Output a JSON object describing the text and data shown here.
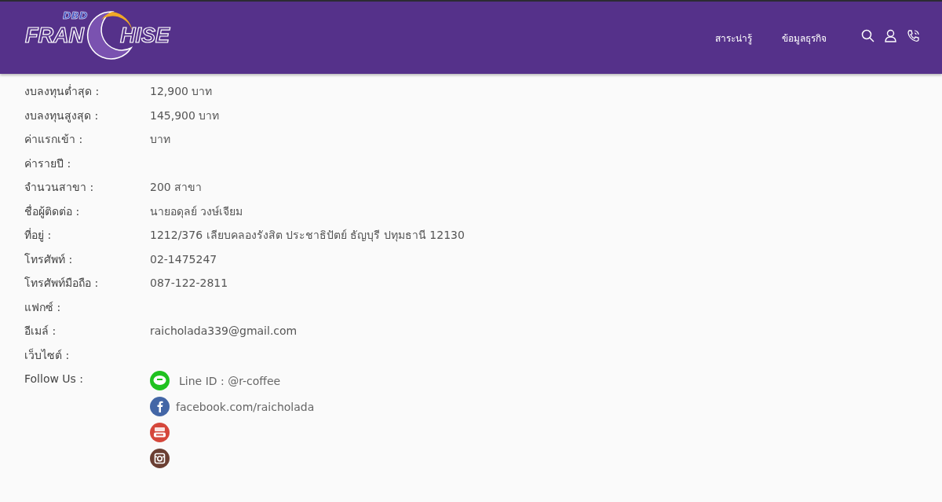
{
  "header": {
    "logo": {
      "top": "DBD",
      "left": "FRAN",
      "right": "HISE"
    },
    "nav": [
      {
        "label": "สาระน่ารู้"
      },
      {
        "label": "ข้อมูลธุรกิจ"
      }
    ],
    "icons": [
      {
        "kind": "search"
      },
      {
        "kind": "user"
      },
      {
        "kind": "phone"
      }
    ]
  },
  "details": [
    {
      "label": "งบลงทุนต่ำสุด :",
      "value": "12,900 บาท"
    },
    {
      "label": "งบลงทุนสูงสุด :",
      "value": "145,900 บาท"
    },
    {
      "label": "ค่าแรกเข้า :",
      "value": "บาท"
    },
    {
      "label": "ค่ารายปี :"
    },
    {
      "label": "จำนวนสาขา :",
      "value": "200 สาขา"
    },
    {
      "label": "ชื่อผู้ติดต่อ :",
      "value": "นายอดุลย์ วงษ์เจียม"
    },
    {
      "label": "ที่อยู่ :",
      "value": "1212/376 เลียบคลองรังสิต ประชาธิปัตย์ ธัญบุรี ปทุมธานี 12130"
    },
    {
      "label": "โทรศัพท์ :",
      "value": "02-1475247"
    },
    {
      "label": "โทรศัพท์มือถือ :",
      "value": "087-122-2811"
    },
    {
      "label": "แฟกซ์ :"
    },
    {
      "label": "อีเมล์ :",
      "value": "raicholada339@gmail.com"
    },
    {
      "label": "เว็บไซต์ :"
    }
  ],
  "follow": {
    "label": "Follow Us :",
    "items": [
      {
        "kind": "line",
        "text": "Line ID : @r-coffee"
      },
      {
        "kind": "facebook",
        "text": "facebook.com/raicholada"
      },
      {
        "kind": "youtube"
      },
      {
        "kind": "instagram"
      }
    ]
  }
}
